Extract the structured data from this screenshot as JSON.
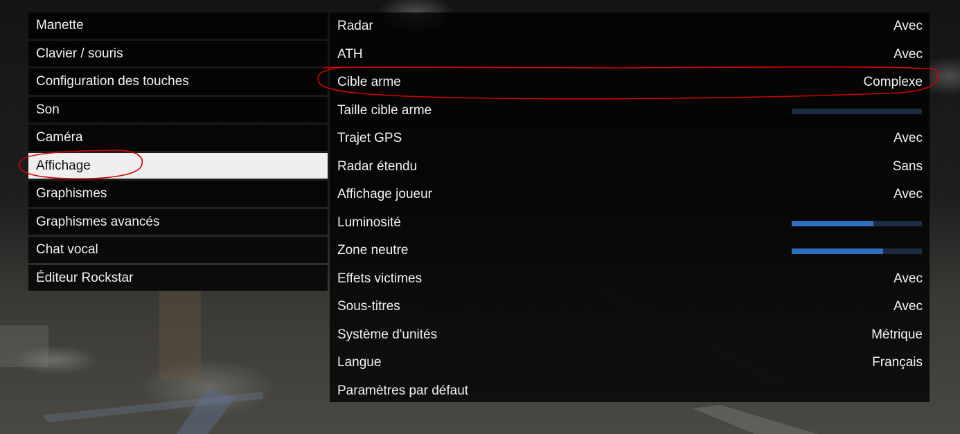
{
  "menu": {
    "items": [
      {
        "label": "Manette"
      },
      {
        "label": "Clavier / souris"
      },
      {
        "label": "Configuration des touches"
      },
      {
        "label": "Son"
      },
      {
        "label": "Caméra"
      },
      {
        "label": "Affichage",
        "selected": true
      },
      {
        "label": "Graphismes"
      },
      {
        "label": "Graphismes avancés"
      },
      {
        "label": "Chat vocal"
      },
      {
        "label": "Éditeur Rockstar"
      }
    ]
  },
  "settings": {
    "rows": [
      {
        "label": "Radar",
        "value": "Avec"
      },
      {
        "label": "ATH",
        "value": "Avec"
      },
      {
        "label": "Cible arme",
        "value": "Complexe"
      },
      {
        "label": "Taille cible arme",
        "slider_level": 0.0
      },
      {
        "label": "Trajet GPS",
        "value": "Avec"
      },
      {
        "label": "Radar étendu",
        "value": "Sans"
      },
      {
        "label": "Affichage joueur",
        "value": "Avec"
      },
      {
        "label": "Luminosité",
        "slider_level": 0.63
      },
      {
        "label": "Zone neutre",
        "slider_level": 0.7
      },
      {
        "label": "Effets victimes",
        "value": "Avec"
      },
      {
        "label": "Sous-titres",
        "value": "Avec"
      },
      {
        "label": "Système d'unités",
        "value": "Métrique"
      },
      {
        "label": "Langue",
        "value": "Français"
      },
      {
        "label": "Paramètres par défaut"
      }
    ]
  },
  "colors": {
    "slider_fill": "#2f6fc0",
    "slider_track": "#1b2c42",
    "annotation": "#d40000",
    "selected_bg": "#efefef"
  }
}
